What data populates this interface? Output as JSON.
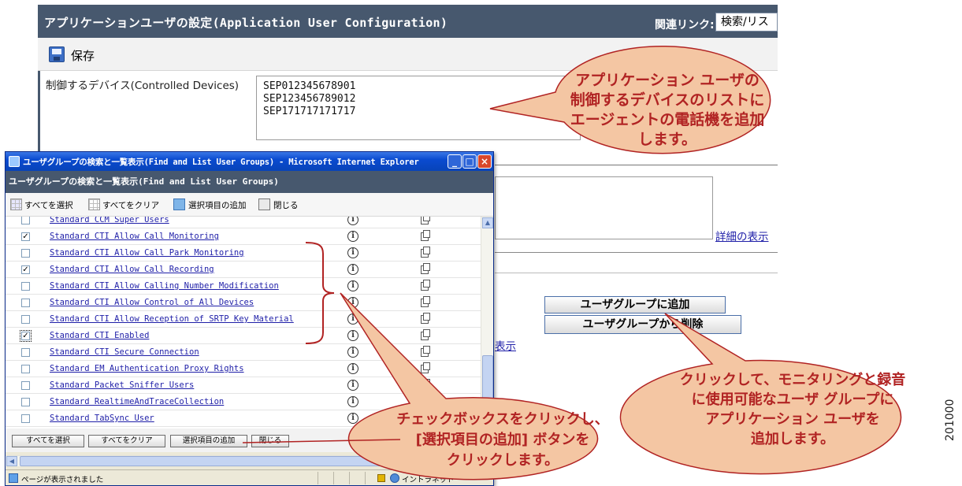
{
  "background": {
    "header_title": "アプリケーションユーザの設定(Application User Configuration)",
    "related_links_label": "関連リンク:",
    "related_links_value": "検索/リス",
    "save_label": "保存",
    "controlled_devices_label": "制御するデバイス(Controlled Devices)",
    "devices": [
      "SEP012345678901",
      "SEP123456789012",
      "SEP171717171717"
    ],
    "detail_link": "詳細の表示",
    "add_group_button": "ユーザグループに追加",
    "remove_group_button": "ユーザグループから削除",
    "show_link": "表示"
  },
  "popup": {
    "window_title": "ユーザグループの検索と一覧表示(Find and List User Groups) - Microsoft Internet Explorer",
    "page_heading": "ユーザグループの検索と一覧表示(Find and List User Groups)",
    "toolbar": {
      "select_all": "すべてを選択",
      "clear_all": "すべてをクリア",
      "add_selected": "選択項目の追加",
      "close": "閉じる"
    },
    "groups": [
      {
        "name": "Standard CCM Super Users",
        "checked": false
      },
      {
        "name": "Standard CTI Allow Call Monitoring",
        "checked": true
      },
      {
        "name": "Standard CTI Allow Call Park Monitoring",
        "checked": false
      },
      {
        "name": "Standard CTI Allow Call Recording",
        "checked": true
      },
      {
        "name": "Standard CTI Allow Calling Number Modification",
        "checked": false
      },
      {
        "name": "Standard CTI Allow Control of All Devices",
        "checked": false
      },
      {
        "name": "Standard CTI Allow Reception of SRTP Key Material",
        "checked": false
      },
      {
        "name": "Standard CTI Enabled",
        "checked": true
      },
      {
        "name": "Standard CTI Secure Connection",
        "checked": false
      },
      {
        "name": "Standard EM Authentication Proxy Rights",
        "checked": false
      },
      {
        "name": "Standard Packet Sniffer Users",
        "checked": false
      },
      {
        "name": "Standard RealtimeAndTraceCollection",
        "checked": false
      },
      {
        "name": "Standard TabSync User",
        "checked": false
      }
    ],
    "bottom_buttons": {
      "select_all": "すべてを選択",
      "clear_all": "すべてをクリア",
      "add_selected": "選択項目の追加",
      "close": "閉じる"
    },
    "status_text": "ページが表示されました",
    "zone_text": "イントラネット"
  },
  "callouts": {
    "top": [
      "アプリケーション ユーザの",
      "制御するデバイスのリストに",
      "エージェントの電話機を追加",
      "します。"
    ],
    "middle": [
      "チェックボックスをクリックし、",
      "[選択項目の追加] ボタンを",
      "クリックします。"
    ],
    "right": [
      "クリックして、モニタリングと録音",
      "に使用可能なユーザ グループに",
      "アプリケーション ユーザを",
      "追加します。"
    ]
  },
  "figure_id": "201000",
  "colors": {
    "header_bg": "#47586e",
    "callout_fill": "#f4c6a3",
    "callout_stroke": "#b12323",
    "link": "#1f1fa8",
    "bracket": "#b12323"
  }
}
